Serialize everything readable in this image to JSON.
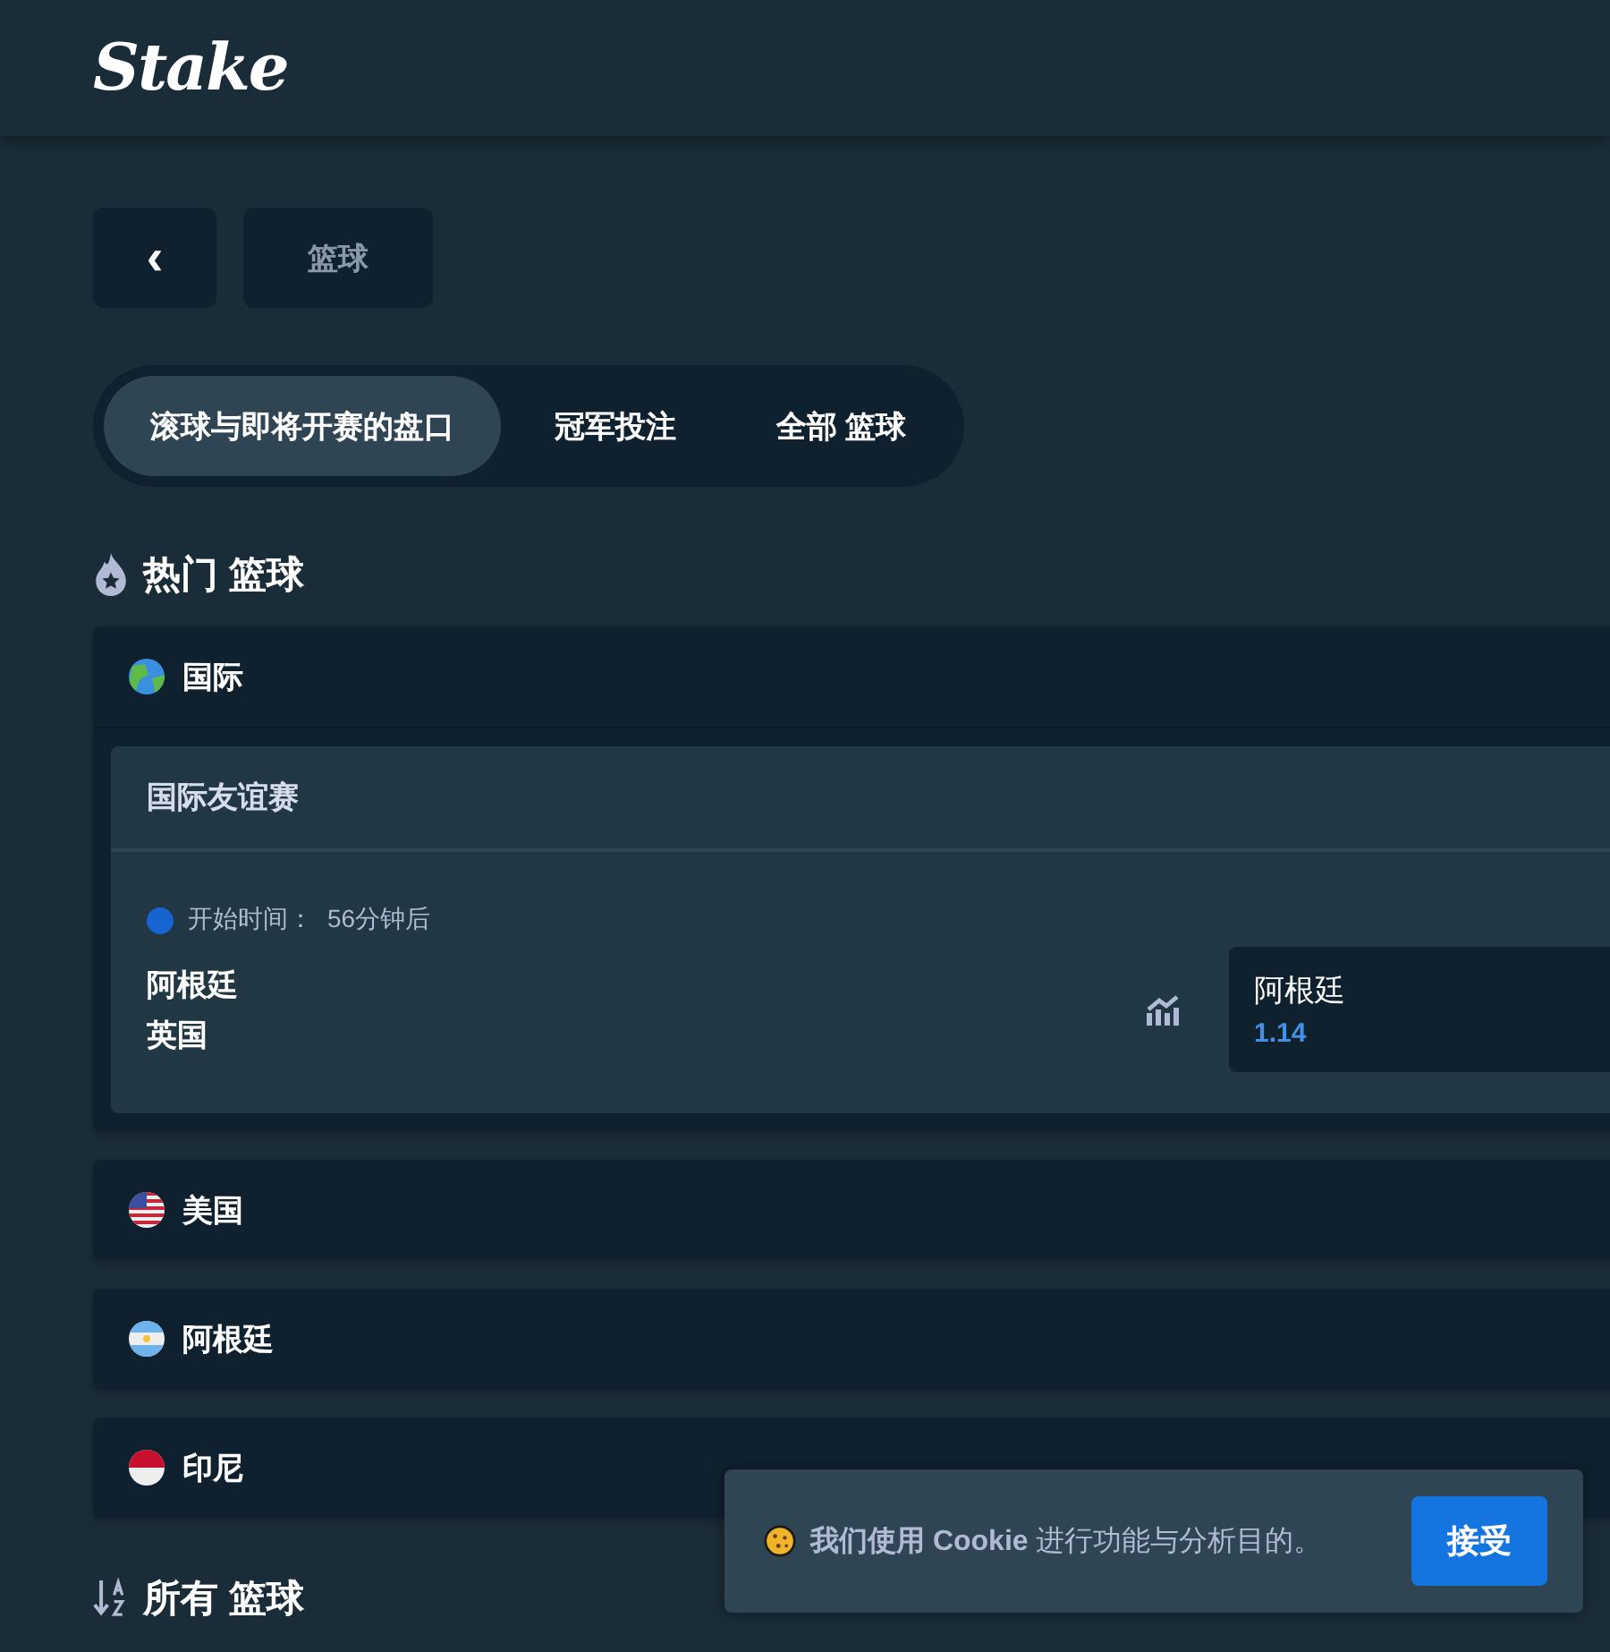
{
  "header": {
    "logo": "Stake"
  },
  "breadcrumb": {
    "back": "‹",
    "current": "篮球"
  },
  "tabs": [
    {
      "label": "滚球与即将开赛的盘口",
      "selected": true
    },
    {
      "label": "冠军投注",
      "selected": false
    },
    {
      "label": "全部 篮球",
      "selected": false
    }
  ],
  "popular_section": {
    "title": "热门 篮球"
  },
  "countries": [
    {
      "name": "国际",
      "kind": "globe",
      "expanded": true,
      "leagues": [
        {
          "name": "国际友谊赛",
          "fixtures": [
            {
              "start_label": "开始时间：",
              "start_time": "56分钟后",
              "teams": [
                "阿根廷",
                "英国"
              ],
              "outcome": {
                "team": "阿根廷",
                "odds": "1.14"
              }
            }
          ]
        }
      ]
    },
    {
      "name": "美国",
      "kind": "us",
      "expanded": false
    },
    {
      "name": "阿根廷",
      "kind": "ar",
      "expanded": false
    },
    {
      "name": "印尼",
      "kind": "id",
      "expanded": false
    }
  ],
  "all_section": {
    "title": "所有 篮球"
  },
  "cookie_notice": {
    "text": "**我们使用 Cookie** 进行功能与分析目的。",
    "accept": "接受"
  }
}
